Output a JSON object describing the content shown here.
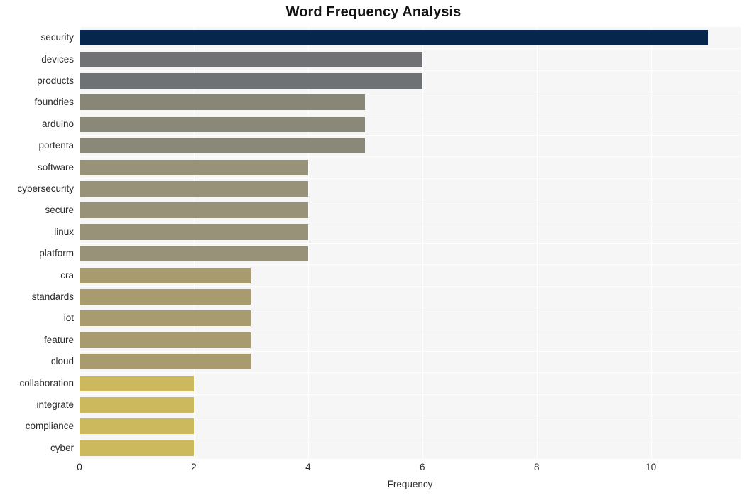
{
  "chart_data": {
    "type": "bar",
    "orientation": "horizontal",
    "title": "Word Frequency Analysis",
    "xlabel": "Frequency",
    "ylabel": "",
    "categories": [
      "security",
      "devices",
      "products",
      "foundries",
      "arduino",
      "portenta",
      "software",
      "cybersecurity",
      "secure",
      "linux",
      "platform",
      "cra",
      "standards",
      "iot",
      "feature",
      "cloud",
      "collaboration",
      "integrate",
      "compliance",
      "cyber"
    ],
    "values": [
      11,
      6,
      6,
      5,
      5,
      5,
      4,
      4,
      4,
      4,
      4,
      3,
      3,
      3,
      3,
      3,
      2,
      2,
      2,
      2
    ],
    "bar_colors": [
      "#06264d",
      "#6f7175",
      "#6f7275",
      "#888677",
      "#8a8878",
      "#8a8878",
      "#989279",
      "#989279",
      "#989279",
      "#989279",
      "#989279",
      "#a89c6f",
      "#a89c6f",
      "#a89c6f",
      "#a89c6f",
      "#a89c6f",
      "#cdb95d",
      "#cdb95d",
      "#cdb95d",
      "#cdb95d"
    ],
    "xticks": [
      0,
      2,
      4,
      6,
      8,
      10
    ],
    "xtick_labels": [
      "0",
      "2",
      "4",
      "6",
      "8",
      "10"
    ],
    "xlim": [
      0,
      11.57
    ],
    "grid": true,
    "grid_color": "#ffffff",
    "plot_background": "#f6f6f7",
    "figure_background": "#ffffff",
    "legend": null,
    "title_color": "#121212",
    "tick_color": "#2b2b2b"
  }
}
